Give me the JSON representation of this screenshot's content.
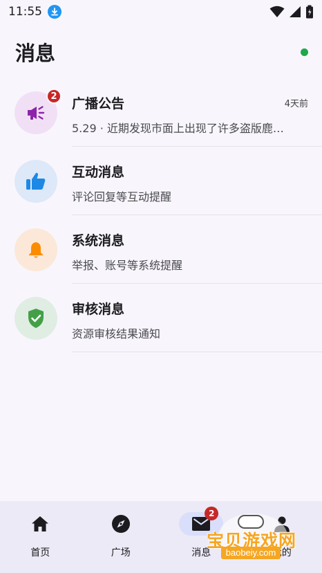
{
  "status_bar": {
    "time": "11:55",
    "icons": [
      "download-icon",
      "wifi-icon",
      "signal-icon",
      "battery-icon"
    ]
  },
  "header": {
    "title": "消息",
    "online_color": "#1fa84a"
  },
  "messages": [
    {
      "title": "广播公告",
      "subtitle": "5.29 · 近期发现市面上出现了许多盗版鹿…",
      "time": "4天前",
      "badge": "2",
      "icon": "megaphone-icon",
      "avatar_bg": "#f1e0f5",
      "icon_color": "#8e24aa"
    },
    {
      "title": "互动消息",
      "subtitle": "评论回复等互动提醒",
      "time": "",
      "badge": "",
      "icon": "thumbs-up-icon",
      "avatar_bg": "#dde8f8",
      "icon_color": "#1e88e5"
    },
    {
      "title": "系统消息",
      "subtitle": "举报、账号等系统提醒",
      "time": "",
      "badge": "",
      "icon": "bell-icon",
      "avatar_bg": "#fbe8d8",
      "icon_color": "#fb8c00"
    },
    {
      "title": "审核消息",
      "subtitle": "资源审核结果通知",
      "time": "",
      "badge": "",
      "icon": "shield-check-icon",
      "avatar_bg": "#e0ede3",
      "icon_color": "#43a047"
    }
  ],
  "bottom_nav": {
    "items": [
      {
        "label": "首页",
        "icon": "home-icon"
      },
      {
        "label": "广场",
        "icon": "compass-icon"
      },
      {
        "label": "消息",
        "icon": "mail-icon",
        "badge": "2",
        "active": true
      },
      {
        "label": "我的",
        "icon": "person-icon"
      }
    ],
    "active_color": "#d9defa"
  },
  "watermark": {
    "cn": "宝贝游戏网",
    "en": "baobeiy.com"
  }
}
